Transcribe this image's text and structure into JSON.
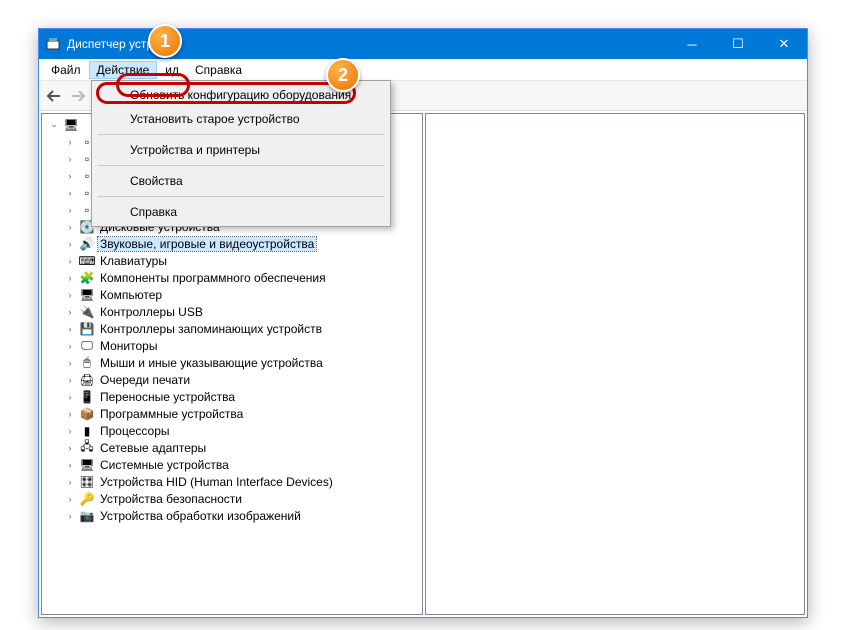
{
  "title": "Диспетчер устр",
  "menu": {
    "file": "Файл",
    "action": "Действие",
    "view": "ид",
    "help": "Справка"
  },
  "dropdown": {
    "update": "Обновить конфигурацию оборудования",
    "legacy": "Установить старое устройство",
    "devices": "Устройства и принтеры",
    "props": "Свойства",
    "help": "Справка"
  },
  "tree": [
    {
      "label": "Дисковые устройства",
      "icon": "💽"
    },
    {
      "label": "Звуковые, игровые и видеоустройства",
      "icon": "🔊",
      "selected": true
    },
    {
      "label": "Клавиатуры",
      "icon": "⌨"
    },
    {
      "label": "Компоненты программного обеспечения",
      "icon": "🧩"
    },
    {
      "label": "Компьютер",
      "icon": "🖥"
    },
    {
      "label": "Контроллеры USB",
      "icon": "🔌"
    },
    {
      "label": "Контроллеры запоминающих устройств",
      "icon": "💾"
    },
    {
      "label": "Мониторы",
      "icon": "🖵"
    },
    {
      "label": "Мыши и иные указывающие устройства",
      "icon": "🖱"
    },
    {
      "label": "Очереди печати",
      "icon": "🖨"
    },
    {
      "label": "Переносные устройства",
      "icon": "📱"
    },
    {
      "label": "Программные устройства",
      "icon": "📦"
    },
    {
      "label": "Процессоры",
      "icon": "▮"
    },
    {
      "label": "Сетевые адаптеры",
      "icon": "🖧"
    },
    {
      "label": "Системные устройства",
      "icon": "🖥"
    },
    {
      "label": "Устройства HID (Human Interface Devices)",
      "icon": "🎛"
    },
    {
      "label": "Устройства безопасности",
      "icon": "🔑"
    },
    {
      "label": "Устройства обработки изображений",
      "icon": "📷"
    }
  ],
  "badges": {
    "one": "1",
    "two": "2"
  }
}
